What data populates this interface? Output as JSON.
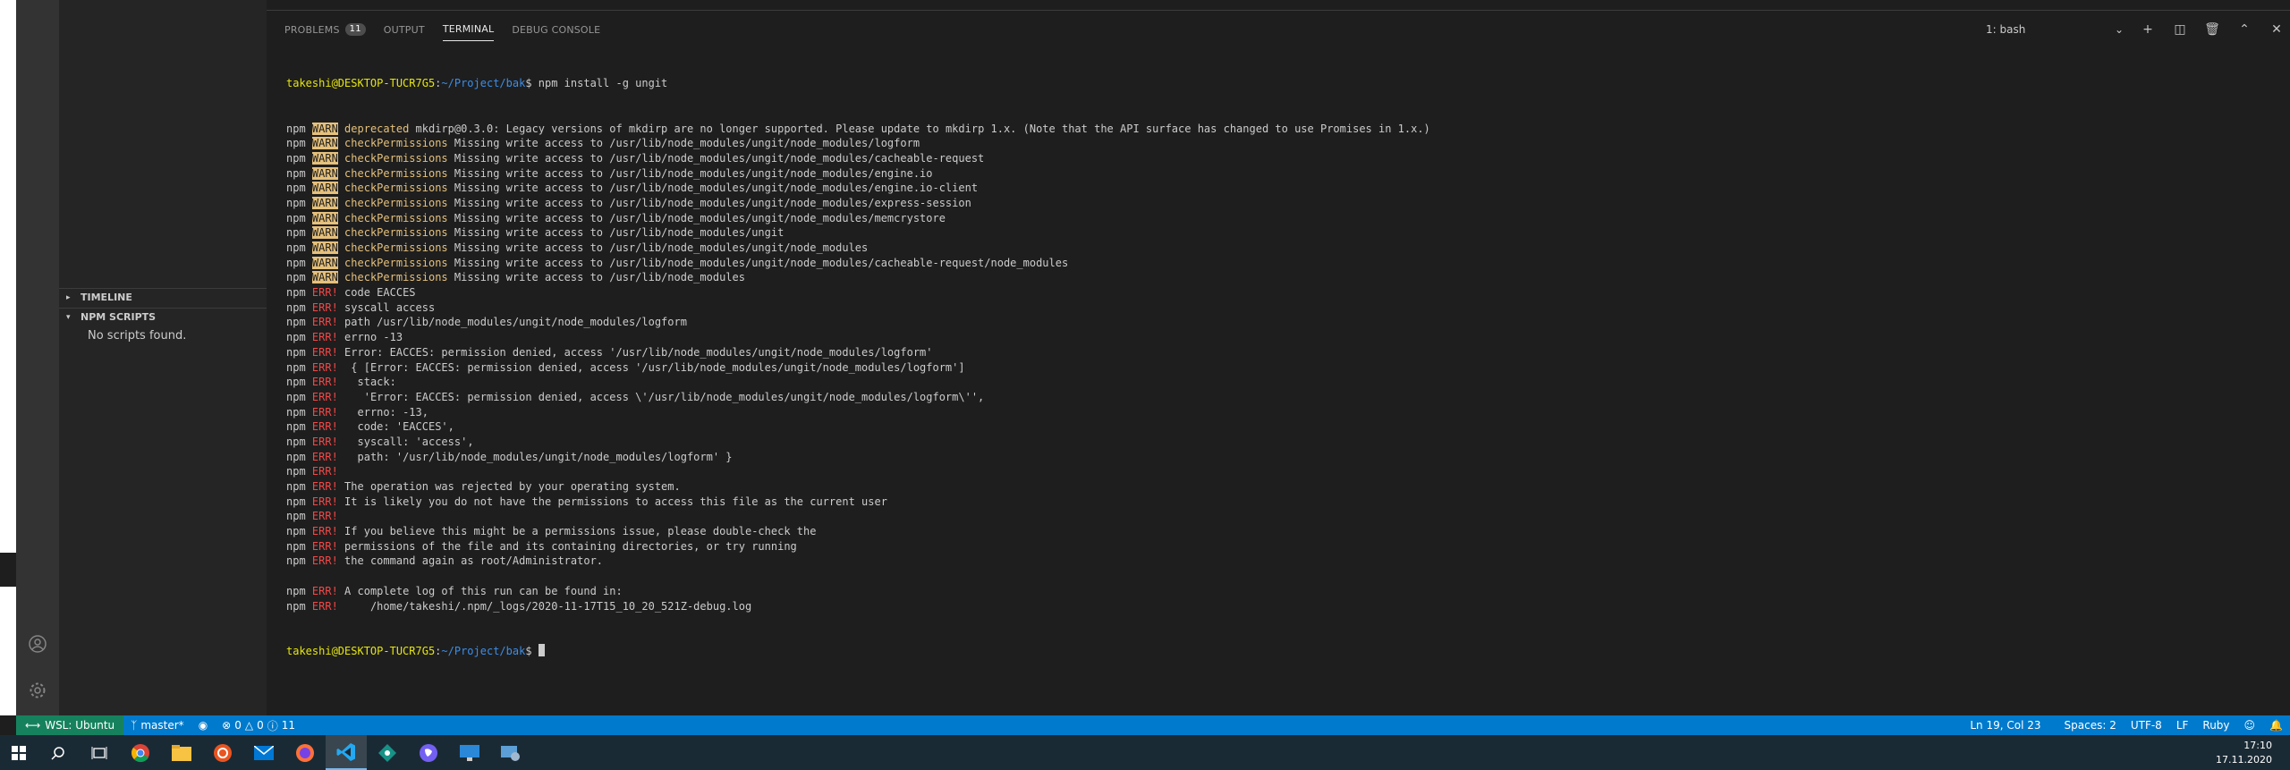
{
  "panel": {
    "tabs": [
      {
        "label": "PROBLEMS",
        "badge": "11"
      },
      {
        "label": "OUTPUT"
      },
      {
        "label": "TERMINAL"
      },
      {
        "label": "DEBUG CONSOLE"
      }
    ],
    "terminal_select": "1: bash"
  },
  "sidebar": {
    "timeline": "TIMELINE",
    "npm_scripts": "NPM SCRIPTS",
    "no_scripts": "No scripts found."
  },
  "terminal": {
    "prompt_user": "takeshi@DESKTOP-TUCR7G5",
    "prompt_path": "~/Project/bak",
    "command": "npm install -g ungit",
    "lines": [
      {
        "lvl": "WARN",
        "kw": "deprecated",
        "text": " mkdirp@0.3.0: Legacy versions of mkdirp are no longer supported. Please update to mkdirp 1.x. (Note that the API surface has changed to use Promises in 1.x.)"
      },
      {
        "lvl": "WARN",
        "kw": "checkPermissions",
        "text": " Missing write access to /usr/lib/node_modules/ungit/node_modules/logform"
      },
      {
        "lvl": "WARN",
        "kw": "checkPermissions",
        "text": " Missing write access to /usr/lib/node_modules/ungit/node_modules/cacheable-request"
      },
      {
        "lvl": "WARN",
        "kw": "checkPermissions",
        "text": " Missing write access to /usr/lib/node_modules/ungit/node_modules/engine.io"
      },
      {
        "lvl": "WARN",
        "kw": "checkPermissions",
        "text": " Missing write access to /usr/lib/node_modules/ungit/node_modules/engine.io-client"
      },
      {
        "lvl": "WARN",
        "kw": "checkPermissions",
        "text": " Missing write access to /usr/lib/node_modules/ungit/node_modules/express-session"
      },
      {
        "lvl": "WARN",
        "kw": "checkPermissions",
        "text": " Missing write access to /usr/lib/node_modules/ungit/node_modules/memcrystore"
      },
      {
        "lvl": "WARN",
        "kw": "checkPermissions",
        "text": " Missing write access to /usr/lib/node_modules/ungit"
      },
      {
        "lvl": "WARN",
        "kw": "checkPermissions",
        "text": " Missing write access to /usr/lib/node_modules/ungit/node_modules"
      },
      {
        "lvl": "WARN",
        "kw": "checkPermissions",
        "text": " Missing write access to /usr/lib/node_modules/ungit/node_modules/cacheable-request/node_modules"
      },
      {
        "lvl": "WARN",
        "kw": "checkPermissions",
        "text": " Missing write access to /usr/lib/node_modules"
      },
      {
        "lvl": "ERR!",
        "kw": "code",
        "text": " EACCES"
      },
      {
        "lvl": "ERR!",
        "kw": "syscall",
        "text": " access"
      },
      {
        "lvl": "ERR!",
        "kw": "path",
        "text": " /usr/lib/node_modules/ungit/node_modules/logform"
      },
      {
        "lvl": "ERR!",
        "kw": "errno",
        "text": " -13"
      },
      {
        "lvl": "ERR!",
        "kw": "",
        "text": "Error: EACCES: permission denied, access '/usr/lib/node_modules/ungit/node_modules/logform'"
      },
      {
        "lvl": "ERR!",
        "kw": "",
        "text": " { [Error: EACCES: permission denied, access '/usr/lib/node_modules/ungit/node_modules/logform']"
      },
      {
        "lvl": "ERR!",
        "kw": "",
        "text": "  stack:"
      },
      {
        "lvl": "ERR!",
        "kw": "",
        "text": "   'Error: EACCES: permission denied, access \\'/usr/lib/node_modules/ungit/node_modules/logform\\'',"
      },
      {
        "lvl": "ERR!",
        "kw": "",
        "text": "  errno: -13,"
      },
      {
        "lvl": "ERR!",
        "kw": "",
        "text": "  code: 'EACCES',"
      },
      {
        "lvl": "ERR!",
        "kw": "",
        "text": "  syscall: 'access',"
      },
      {
        "lvl": "ERR!",
        "kw": "",
        "text": "  path: '/usr/lib/node_modules/ungit/node_modules/logform' }"
      },
      {
        "lvl": "ERR!",
        "kw": "",
        "text": ""
      },
      {
        "lvl": "ERR!",
        "kw": "",
        "text": "The operation was rejected by your operating system."
      },
      {
        "lvl": "ERR!",
        "kw": "",
        "text": "It is likely you do not have the permissions to access this file as the current user"
      },
      {
        "lvl": "ERR!",
        "kw": "",
        "text": ""
      },
      {
        "lvl": "ERR!",
        "kw": "",
        "text": "If you believe this might be a permissions issue, please double-check the"
      },
      {
        "lvl": "ERR!",
        "kw": "",
        "text": "permissions of the file and its containing directories, or try running"
      },
      {
        "lvl": "ERR!",
        "kw": "",
        "text": "the command again as root/Administrator."
      },
      {
        "lvl": "",
        "kw": "",
        "text": ""
      },
      {
        "lvl": "ERR!",
        "kw": "",
        "text": "A complete log of this run can be found in:"
      },
      {
        "lvl": "ERR!",
        "kw": "",
        "text": "    /home/takeshi/.npm/_logs/2020-11-17T15_10_20_521Z-debug.log"
      }
    ]
  },
  "statusbar": {
    "remote": "WSL: Ubuntu",
    "branch": "master*",
    "errors": "0",
    "warnings": "0",
    "info": "11",
    "position": "Ln 19, Col 23",
    "spaces": "Spaces: 2",
    "encoding": "UTF-8",
    "eol": "LF",
    "language": "Ruby"
  },
  "taskbar": {
    "time": "17:10",
    "date": "17.11.2020"
  }
}
